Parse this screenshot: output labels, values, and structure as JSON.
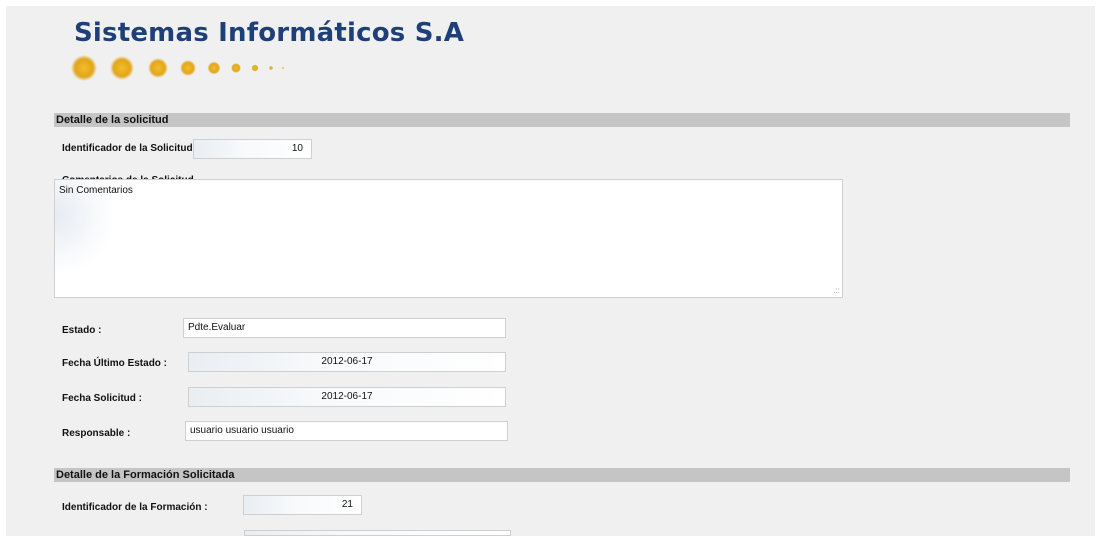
{
  "logo": {
    "title": "Sistemas Informáticos S.A",
    "dots_color": "#e0a81a"
  },
  "sections": {
    "request_detail": "Detalle de la solicitud",
    "training_detail": "Detalle de la Formación Solicitada"
  },
  "request": {
    "id_label": "Identificador de la Solicitud :",
    "id_value": "10",
    "comments_label": "Comentarios de la Solicitud",
    "comments_value": "Sin Comentarios",
    "status_label": "Estado :",
    "status_value": "Pdte.Evaluar",
    "last_status_date_label": "Fecha Último Estado :",
    "last_status_date_value": "2012-06-17",
    "request_date_label": "Fecha Solicitud :",
    "request_date_value": "2012-06-17",
    "responsible_label": "Responsable :",
    "responsible_value": "usuario usuario usuario"
  },
  "training": {
    "id_label": "Identificador de la Formación :",
    "id_value": "21",
    "next_field_value": ""
  },
  "colors": {
    "section_bar": "#c5c5c5",
    "page_background": "#f0f0f0",
    "logo_text": "#1f3f78"
  }
}
